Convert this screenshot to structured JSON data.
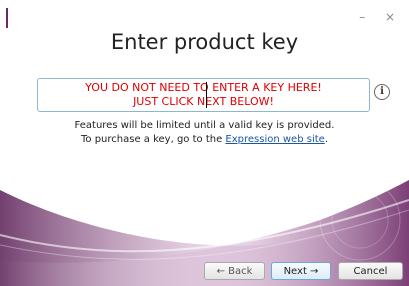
{
  "window": {
    "controls": "– ×"
  },
  "title": "Enter product key",
  "key_field": {
    "line1": "YOU DO NOT NEED TO ENTER A KEY HERE!",
    "line2": "JUST CLICK NEXT BELOW!"
  },
  "info_icon": {
    "icon": "info-icon",
    "glyph": "i"
  },
  "message": {
    "line1": "Features will be limited until a valid key is provided.",
    "line2_prefix": "To purchase a key, go to the ",
    "link": "Expression web site",
    "line2_suffix": "."
  },
  "buttons": {
    "back": "← Back",
    "next": "Next →",
    "cancel": "Cancel"
  },
  "colors": {
    "accent": "#6a2a66",
    "key_text": "#e00000",
    "link": "#1a55a8"
  }
}
